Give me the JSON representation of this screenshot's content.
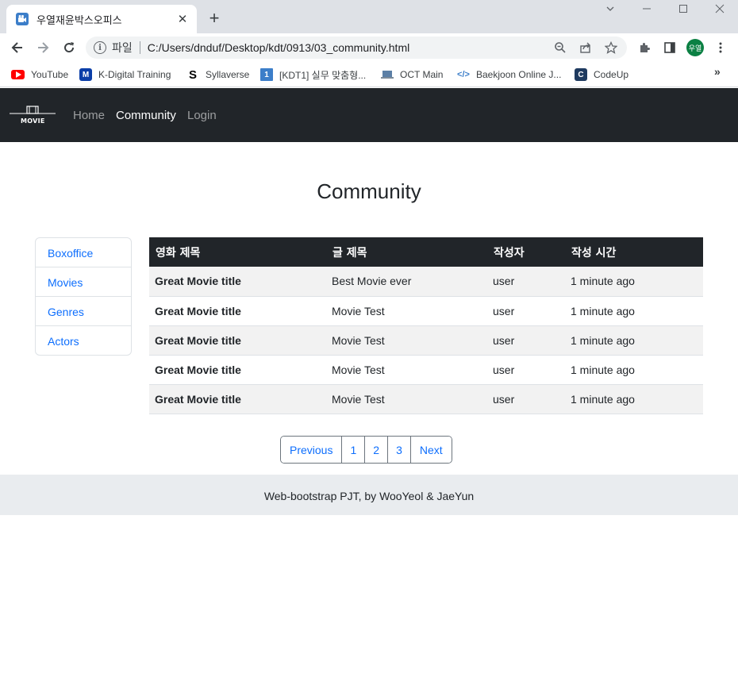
{
  "browser": {
    "tab_title": "우열재윤박스오피스",
    "tab_close": "✕",
    "new_tab": "+",
    "file_label": "파일",
    "url": "C:/Users/dnduf/Desktop/kdt/0913/03_community.html",
    "profile_label": "우열",
    "bookmarks": [
      {
        "label": "YouTube",
        "icon": "youtube-icon",
        "color": "#ff0000"
      },
      {
        "label": "K-Digital Training",
        "icon": "k-digital-icon",
        "color": "#0b3ea8"
      },
      {
        "label": "Syllaverse",
        "icon": "syllaverse-icon",
        "color": "#000000"
      },
      {
        "label": "[KDT1] 실무 맞춤형...",
        "icon": "kdt-icon",
        "color": "#3c7ec9"
      },
      {
        "label": "OCT Main",
        "icon": "laptop-icon",
        "color": "#5f6368"
      },
      {
        "label": "Baekjoon Online J...",
        "icon": "code-icon",
        "color": "#3c7ec9"
      },
      {
        "label": "CodeUp",
        "icon": "codeup-icon",
        "color": "#1e3a5f"
      }
    ],
    "bookmarks_more": "»"
  },
  "navbar": {
    "brand": "MOVIE",
    "links": [
      "Home",
      "Community",
      "Login"
    ],
    "active": "Community"
  },
  "main": {
    "title": "Community",
    "sidebar": [
      "Boxoffice",
      "Movies",
      "Genres",
      "Actors"
    ],
    "table": {
      "headers": [
        "영화 제목",
        "글 제목",
        "작성자",
        "작성 시간"
      ],
      "rows": [
        [
          "Great Movie title",
          "Best Movie ever",
          "user",
          "1 minute ago"
        ],
        [
          "Great Movie title",
          "Movie Test",
          "user",
          "1 minute ago"
        ],
        [
          "Great Movie title",
          "Movie Test",
          "user",
          "1 minute ago"
        ],
        [
          "Great Movie title",
          "Movie Test",
          "user",
          "1 minute ago"
        ],
        [
          "Great Movie title",
          "Movie Test",
          "user",
          "1 minute ago"
        ]
      ]
    },
    "pagination": {
      "previous": "Previous",
      "pages": [
        "1",
        "2",
        "3"
      ],
      "next": "Next"
    }
  },
  "footer": {
    "text": "Web-bootstrap PJT, by WooYeol & JaeYun"
  },
  "colors": {
    "navbar": "#212529",
    "link": "#0d6efd",
    "footer": "#e9ecef"
  }
}
